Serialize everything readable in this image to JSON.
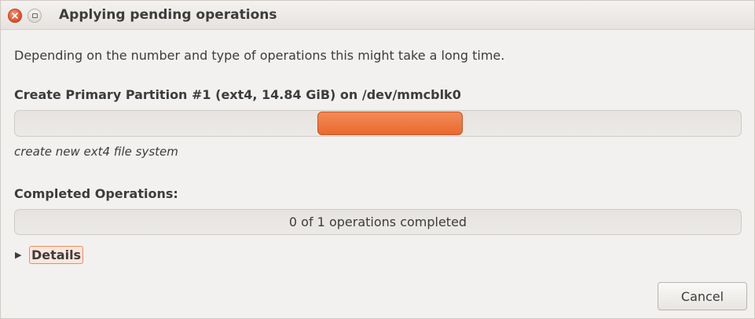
{
  "window": {
    "title": "Applying pending operations",
    "close_icon": "close-icon",
    "maximize_icon": "maximize-icon"
  },
  "description": "Depending on the number and type of operations this might take a long time.",
  "current_operation": {
    "label": "Create Primary Partition #1 (ext4, 14.84 GiB) on /dev/mmcblk0",
    "progress_mode": "indeterminate-pulse",
    "status": "create new ext4 file system"
  },
  "completed": {
    "label": "Completed Operations:",
    "progress_text": "0 of 1 operations completed",
    "progress_fraction": 0
  },
  "details": {
    "label": "Details",
    "expanded": false,
    "icon": "triangle-right-icon"
  },
  "buttons": {
    "cancel": "Cancel"
  },
  "colors": {
    "accent": "#e86a2e",
    "close_button": "#e5542e",
    "background": "#f2f1f0"
  }
}
